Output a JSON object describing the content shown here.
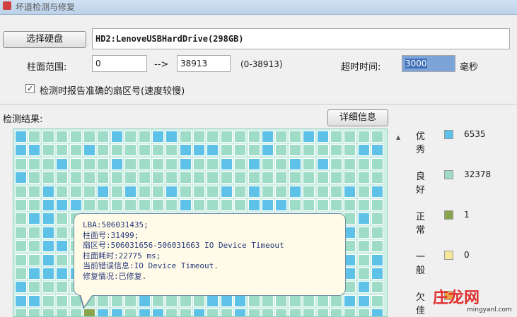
{
  "window": {
    "title": "坏道检测与修复"
  },
  "toolbar": {
    "select_disk_label": "选择硬盘",
    "drive_text": "HD2:LenoveUSBHardDrive(298GB)"
  },
  "range": {
    "label": "柱面范围:",
    "start": "0",
    "arrow": "-->",
    "end": "38913",
    "hint": "(0-38913)"
  },
  "timeout": {
    "label": "超时时间:",
    "value": "3000",
    "unit": "毫秒"
  },
  "option": {
    "checked": true,
    "label": "检测时报告准确的扇区号(速度较慢)"
  },
  "results": {
    "label": "检测结果:",
    "details_button": "详细信息"
  },
  "tooltip": {
    "lines": [
      "LBA:506031435;",
      "柱面号:31499;",
      "扇区号:506031656-506031663  IO Device Timeout",
      "柱面耗时:22775 ms;",
      "当前错误信息:IO Device Timeout.",
      "修复情况:已修复."
    ]
  },
  "legend": [
    {
      "label": "优秀",
      "color": "#5ec2e8",
      "count": "6535"
    },
    {
      "label": "良好",
      "color": "#9fdcc7",
      "count": "32378"
    },
    {
      "label": "正常",
      "color": "#8aa44e",
      "count": "1"
    },
    {
      "label": "一般",
      "color": "#f5e79a",
      "count": "0"
    },
    {
      "label": "欠佳",
      "color": "#f0a040",
      "count": ""
    }
  ],
  "watermark": {
    "brand": "庄龙网",
    "site": "mingyanl.com"
  }
}
